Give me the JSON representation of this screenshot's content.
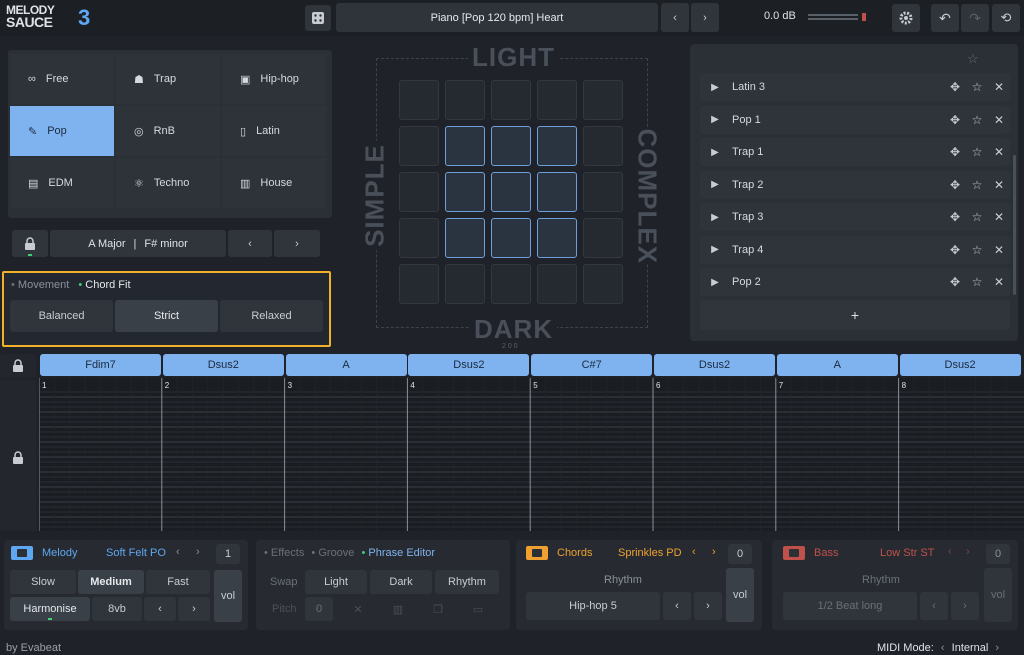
{
  "app": {
    "logo_line1": "MELODY",
    "logo_line2": "SAUCE",
    "logo_num": "3"
  },
  "topbar": {
    "preset": "Piano  [Pop 120 bpm]  Heart",
    "volume": "0.0 dB"
  },
  "genres": [
    {
      "label": "Free",
      "icon": "loop-icon"
    },
    {
      "label": "Trap",
      "icon": "hood-icon"
    },
    {
      "label": "Hip-hop",
      "icon": "boombox-icon"
    },
    {
      "label": "Pop",
      "icon": "mic-icon"
    },
    {
      "label": "RnB",
      "icon": "vinyl-icon"
    },
    {
      "label": "Latin",
      "icon": "speaker-icon"
    },
    {
      "label": "EDM",
      "icon": "synth-icon"
    },
    {
      "label": "Techno",
      "icon": "atom-icon"
    },
    {
      "label": "House",
      "icon": "keys-icon"
    }
  ],
  "selected_genre": "Pop",
  "key": {
    "major": "A Major",
    "minor": "F# minor"
  },
  "movement": {
    "tab1": "Movement",
    "tab2": "Chord Fit",
    "options": [
      "Balanced",
      "Strict",
      "Relaxed"
    ],
    "selected": "Strict"
  },
  "pad": {
    "top": "LIGHT",
    "bottom": "DARK",
    "left": "SIMPLE",
    "right": "COMPLEX",
    "readout": "2 0 0"
  },
  "list": {
    "items": [
      "Latin 3",
      "Pop 1",
      "Trap 1",
      "Trap 2",
      "Trap 3",
      "Trap 4",
      "Pop 2"
    ],
    "add": "+"
  },
  "chords": [
    "Fdim7",
    "Dsus2",
    "A",
    "Dsus2",
    "C#7",
    "Dsus2",
    "A",
    "Dsus2"
  ],
  "bars": [
    "1",
    "2",
    "3",
    "4",
    "5",
    "6",
    "7",
    "8"
  ],
  "melody": {
    "title": "Melody",
    "instrument": "Soft Felt PO",
    "count": "1",
    "speed": [
      "Slow",
      "Medium",
      "Fast"
    ],
    "harmonise": "Harmonise",
    "octave": "8vb",
    "vol": "vol"
  },
  "effects": {
    "tabs": [
      "Effects",
      "Groove",
      "Phrase Editor"
    ],
    "swap": "Swap",
    "options": [
      "Light",
      "Dark",
      "Rhythm"
    ],
    "pitch": "Pitch",
    "pitch_val": "0"
  },
  "chords_panel": {
    "title": "Chords",
    "instrument": "Sprinkles PD",
    "count": "0",
    "rhythm": "Rhythm",
    "value": "Hip-hop 5",
    "vol": "vol"
  },
  "bass": {
    "title": "Bass",
    "instrument": "Low Str ST",
    "count": "0",
    "rhythm": "Rhythm",
    "value": "1/2 Beat long",
    "vol": "vol"
  },
  "footer": {
    "credit": "by Evabeat",
    "midi_label": "MIDI Mode:",
    "midi_value": "Internal"
  },
  "colors": {
    "accent": "#7fb3f0",
    "highlight": "#f2b02a",
    "melody": "#5ea7f2",
    "chords": "#f0a030",
    "bass": "#c0504a"
  }
}
